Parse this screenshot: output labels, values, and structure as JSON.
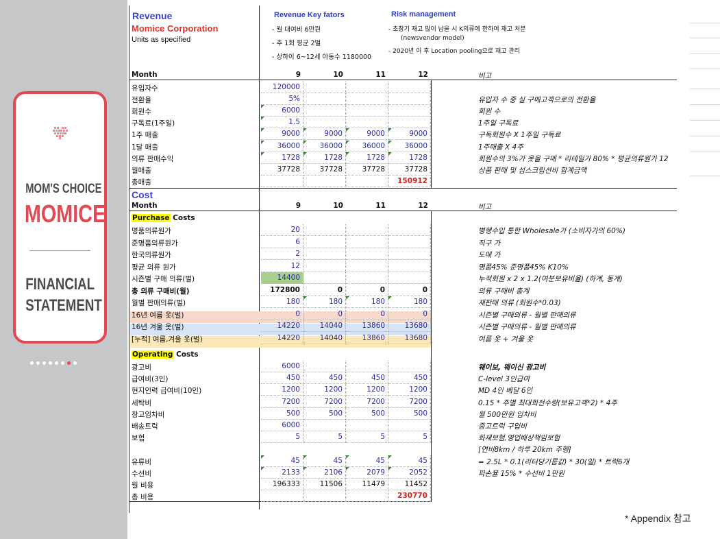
{
  "sidebar": {
    "brand_line1": "MOM'S CHOICE",
    "brand_line2": "MOMICE",
    "title_line1": "FINANCIAL",
    "title_line2": "STATEMENT",
    "page_count": 8,
    "active_page": 7,
    "accent_color": "#e14a52"
  },
  "header": {
    "revenue_title": "Revenue",
    "company": "Momice Corporation",
    "units": "Units as specified",
    "key_factors_title": "Revenue Key fators",
    "key_factors": [
      "- 월 대여비 6만원",
      "- 주 1회 평균 2벌",
      "- 상하이 6~12세 아동수 1180000"
    ],
    "risk_title": "Risk management",
    "risk_lines": [
      "-   초창기 재고 많이 남을 시 K의류에 한하여 재고 처분",
      "(newsvendor model)",
      "-   2020년 이 후 Location pooling으로 재고 관리"
    ]
  },
  "revenue": {
    "month_label": "Month",
    "months": [
      "9",
      "10",
      "11",
      "12"
    ],
    "note_header": "비고",
    "rows": [
      {
        "label": "유입자수",
        "values": [
          "120000",
          "",
          "",
          ""
        ],
        "note": ""
      },
      {
        "label": "전환율",
        "values": [
          "5%",
          "",
          "",
          ""
        ],
        "note": "유입자 수 중 실 구매고객으로의 전환율"
      },
      {
        "label": "회원수",
        "values": [
          "6000",
          "",
          "",
          ""
        ],
        "note": "회원 수"
      },
      {
        "label": "구독료(1주일)",
        "values": [
          "1.5",
          "",
          "",
          ""
        ],
        "note": "1주일 구독료"
      },
      {
        "label": "1주 매출",
        "values": [
          "9000",
          "9000",
          "9000",
          "9000"
        ],
        "note": "구독회원수 X 1주일 구독료"
      },
      {
        "label": "1달 매출",
        "values": [
          "36000",
          "36000",
          "36000",
          "36000"
        ],
        "note": "1주매출 X 4주"
      },
      {
        "label": "의류 판매수익",
        "values": [
          "1728",
          "1728",
          "1728",
          "1728"
        ],
        "note": "회원수의 3%가 옷을 구매 * 리테일가 80% * 평균의류원가 12"
      },
      {
        "label": "월매출",
        "values": [
          "37728",
          "37728",
          "37728",
          "37728"
        ],
        "note": "상품 판매 및 섬스크립션비 합계금액"
      },
      {
        "label": "총매출",
        "values": [
          "",
          "",
          "",
          "150912"
        ],
        "note": ""
      }
    ]
  },
  "cost": {
    "title": "Cost",
    "month_label": "Month",
    "months": [
      "9",
      "10",
      "11",
      "12"
    ],
    "note_header": "비고",
    "purchase_title_hl": "Purchase",
    "purchase_title_rest": " Costs",
    "purchase_rows": [
      {
        "label": "명품의류원가",
        "values": [
          "20",
          "",
          "",
          ""
        ],
        "note": "병행수입 통한 Wholesale가 (소비자가의 60%)"
      },
      {
        "label": "준명품의류원가",
        "values": [
          "6",
          "",
          "",
          ""
        ],
        "note": "직구 가"
      },
      {
        "label": "한국의류원가",
        "values": [
          "2",
          "",
          "",
          ""
        ],
        "note": "도매 가"
      },
      {
        "label": "평균 의류 원가",
        "values": [
          "12",
          "",
          "",
          ""
        ],
        "note": "명품45% 준명품45% K10%"
      },
      {
        "label": "시즌별 구매 의류(벌)",
        "values": [
          "14400",
          "",
          "",
          ""
        ],
        "note": "누적회원 x 2 x 1.2(여분보유비율) (하계, 동계)"
      },
      {
        "label": "총 의류 구매비(월)",
        "values": [
          "172800",
          "0",
          "0",
          "0"
        ],
        "note": "의류 구매비 총계"
      },
      {
        "label": "월별 판매의류(벌)",
        "values": [
          "180",
          "180",
          "180",
          "180"
        ],
        "note": "재판매 의류 (회원수*0.03)"
      },
      {
        "label": "16년 여름 옷(벌)",
        "values": [
          "0",
          "0",
          "0",
          "0"
        ],
        "note": "시즌별 구매의류 - 월별 판매의류"
      },
      {
        "label": "16년 겨울 옷(벌)",
        "values": [
          "14220",
          "14040",
          "13860",
          "13680"
        ],
        "note": "시즌별 구매의류 - 월별 판매의류"
      },
      {
        "label": "[누적] 여름,겨울 옷(벌)",
        "values": [
          "14220",
          "14040",
          "13860",
          "13680"
        ],
        "note": "여름 옷 + 겨울 옷"
      }
    ],
    "operating_title_hl": "Operating",
    "operating_title_rest": " Costs",
    "operating_rows": [
      {
        "label": "광고비",
        "values": [
          "6000",
          "",
          "",
          ""
        ],
        "note": "웨이보, 웨이신 광고비"
      },
      {
        "label": "급여비(3인)",
        "values": [
          "450",
          "450",
          "450",
          "450"
        ],
        "note": "C-level 3인급여"
      },
      {
        "label": "현지인력 급여비(10인)",
        "values": [
          "1200",
          "1200",
          "1200",
          "1200"
        ],
        "note": "MD 4인 배달 6인"
      },
      {
        "label": "세탁비",
        "values": [
          "7200",
          "7200",
          "7200",
          "7200"
        ],
        "note": "0.15 * 주별 최대회전수량(보유고객*2) * 4주"
      },
      {
        "label": "창고임차비",
        "values": [
          "500",
          "500",
          "500",
          "500"
        ],
        "note": "월 500만원 임차비"
      },
      {
        "label": "배송트럭",
        "values": [
          "6000",
          "",
          "",
          ""
        ],
        "note": "중고트럭 구입비"
      },
      {
        "label": "보험",
        "values": [
          "5",
          "5",
          "5",
          "5"
        ],
        "note": "화재보험,영업배상책임보험"
      },
      {
        "label": "",
        "values": [
          "",
          "",
          "",
          ""
        ],
        "note": "[연비8km / 하루 20km 주행]"
      },
      {
        "label": "유류비",
        "values": [
          "45",
          "45",
          "45",
          "45"
        ],
        "note": "= 2.5L * 0.1(리터당기름값) * 30(일) * 트럭6개"
      },
      {
        "label": "수선비",
        "values": [
          "2133",
          "2106",
          "2079",
          "2052"
        ],
        "note": "파손율 15% * 수선비 1만원"
      },
      {
        "label": "월 비용",
        "values": [
          "196333",
          "11506",
          "11479",
          "11452"
        ],
        "note": ""
      },
      {
        "label": "총 비용",
        "values": [
          "",
          "",
          "",
          "230770"
        ],
        "note": ""
      }
    ]
  },
  "footer": {
    "appendix": "* Appendix 참고"
  }
}
